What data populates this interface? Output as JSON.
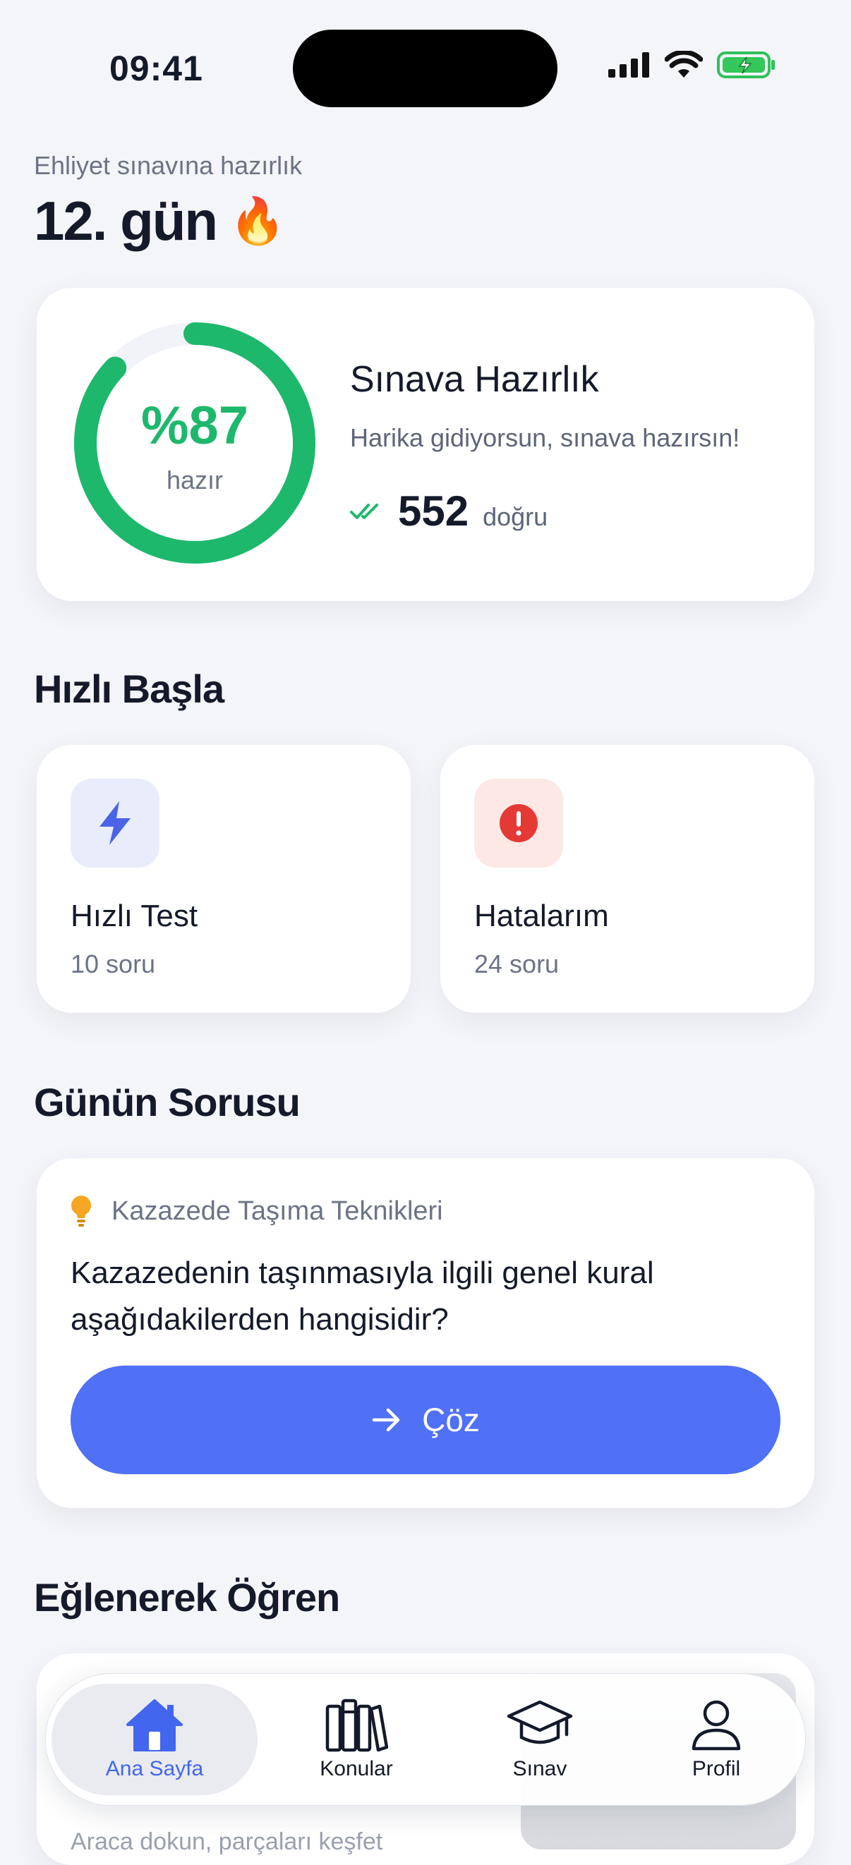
{
  "status_bar": {
    "time": "09:41"
  },
  "header": {
    "subtitle": "Ehliyet sınavına hazırlık",
    "day": "12. gün",
    "emoji": "🔥"
  },
  "progress": {
    "percent_text": "%87",
    "percent_value": 87,
    "percent_sub": "hazır",
    "title": "Sınava Hazırlık",
    "message": "Harika gidiyorsun, sınava hazırsın!",
    "correct_count": "552",
    "correct_label": "doğru",
    "accent": "#1db86c"
  },
  "quick_start": {
    "title": "Hızlı Başla",
    "cards": [
      {
        "title": "Hızlı Test",
        "sub": "10 soru",
        "icon": "lightning-icon",
        "color": "#4a63e7"
      },
      {
        "title": "Hatalarım",
        "sub": "24 soru",
        "icon": "alert-icon",
        "color": "#e53935"
      }
    ]
  },
  "question_of_day": {
    "title": "Günün Sorusu",
    "category": "Kazazede Taşıma Teknikleri",
    "question": "Kazazedenin taşınmasıyla ilgili genel kural aşağıdakilerden hangisidir?",
    "button": "Çöz",
    "button_color": "#5070f6"
  },
  "learn": {
    "title": "Eğlenerek Öğren",
    "hint": "Araca dokun, parçaları keşfet"
  },
  "tabbar": {
    "tabs": [
      {
        "label": "Ana Sayfa",
        "icon": "home-icon",
        "active": true
      },
      {
        "label": "Konular",
        "icon": "books-icon",
        "active": false
      },
      {
        "label": "Sınav",
        "icon": "graduation-cap-icon",
        "active": false
      },
      {
        "label": "Profil",
        "icon": "profile-icon",
        "active": false
      }
    ],
    "active_color": "#4366ee"
  }
}
